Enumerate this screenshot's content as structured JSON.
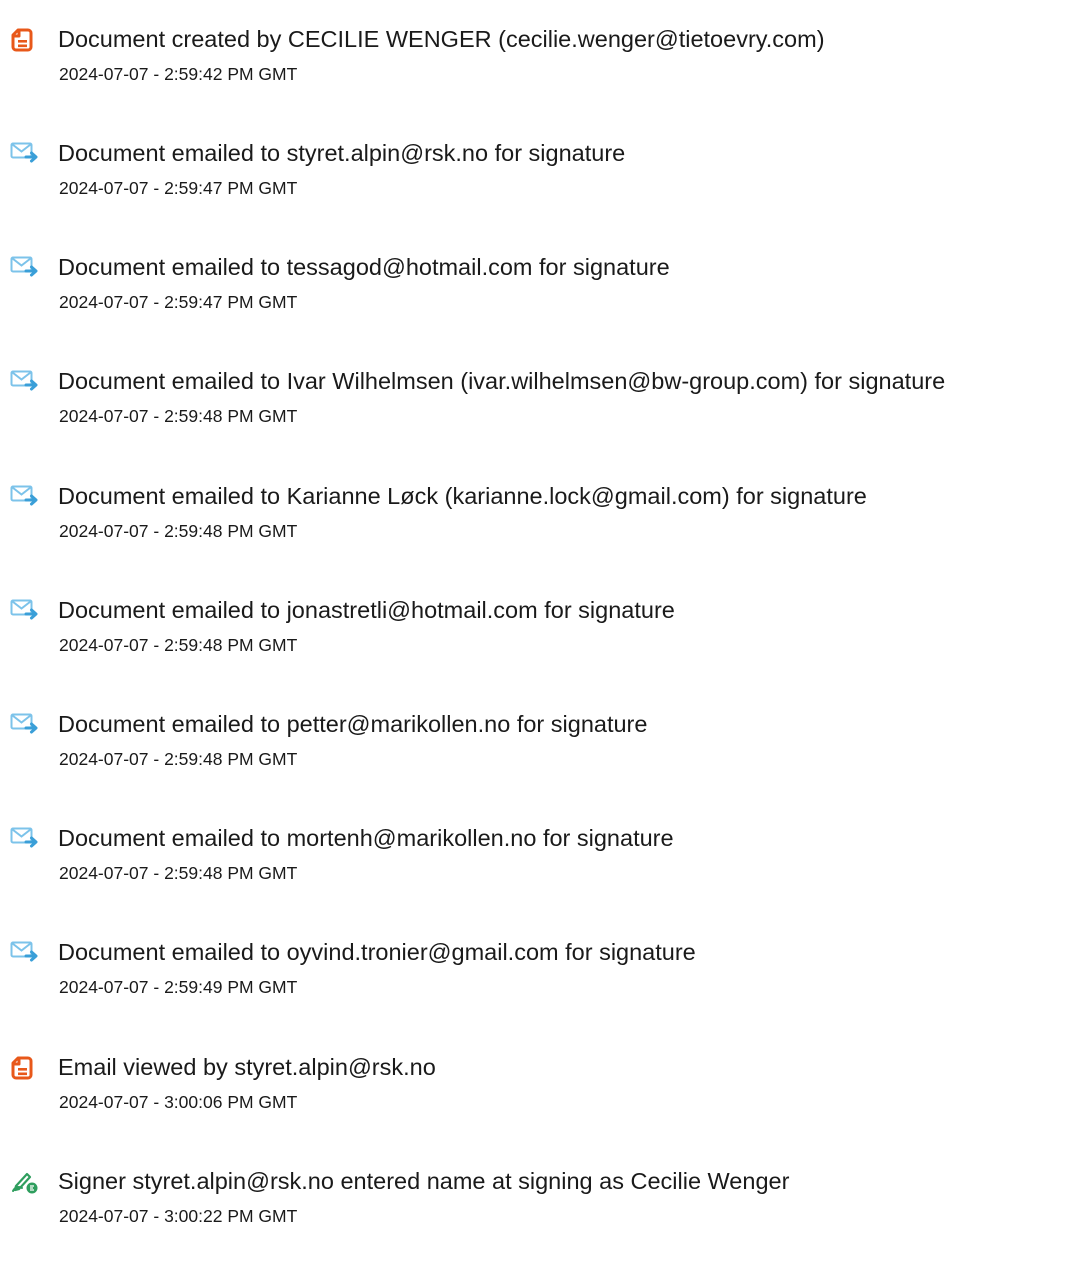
{
  "colors": {
    "doc_icon": "#e8581a",
    "mail_icon": "#3a9fd8",
    "mail_icon_light": "#7cc3ea",
    "sign_icon": "#2f9e5e",
    "text": "#1a1a1a"
  },
  "events": [
    {
      "icon": "document-icon",
      "text": "Document created by CECILIE WENGER (cecilie.wenger@tietoevry.com)",
      "timestamp": "2024-07-07 - 2:59:42 PM GMT"
    },
    {
      "icon": "email-sent-icon",
      "text": "Document emailed to styret.alpin@rsk.no for signature",
      "timestamp": "2024-07-07 - 2:59:47 PM GMT"
    },
    {
      "icon": "email-sent-icon",
      "text": "Document emailed to tessagod@hotmail.com for signature",
      "timestamp": "2024-07-07 - 2:59:47 PM GMT"
    },
    {
      "icon": "email-sent-icon",
      "text": "Document emailed to Ivar Wilhelmsen (ivar.wilhelmsen@bw-group.com) for signature",
      "timestamp": "2024-07-07 - 2:59:48 PM GMT"
    },
    {
      "icon": "email-sent-icon",
      "text": "Document emailed to Karianne Løck (karianne.lock@gmail.com) for signature",
      "timestamp": "2024-07-07 - 2:59:48 PM GMT"
    },
    {
      "icon": "email-sent-icon",
      "text": "Document emailed to jonastretli@hotmail.com for signature",
      "timestamp": "2024-07-07 - 2:59:48 PM GMT"
    },
    {
      "icon": "email-sent-icon",
      "text": "Document emailed to petter@marikollen.no for signature",
      "timestamp": "2024-07-07 - 2:59:48 PM GMT"
    },
    {
      "icon": "email-sent-icon",
      "text": "Document emailed to mortenh@marikollen.no for signature",
      "timestamp": "2024-07-07 - 2:59:48 PM GMT"
    },
    {
      "icon": "email-sent-icon",
      "text": "Document emailed to oyvind.tronier@gmail.com for signature",
      "timestamp": "2024-07-07 - 2:59:49 PM GMT"
    },
    {
      "icon": "document-icon",
      "text": "Email viewed by styret.alpin@rsk.no",
      "timestamp": "2024-07-07 - 3:00:06 PM GMT"
    },
    {
      "icon": "signature-pen-icon",
      "text": "Signer styret.alpin@rsk.no entered name at signing as Cecilie Wenger",
      "timestamp": "2024-07-07 - 3:00:22 PM GMT"
    }
  ]
}
